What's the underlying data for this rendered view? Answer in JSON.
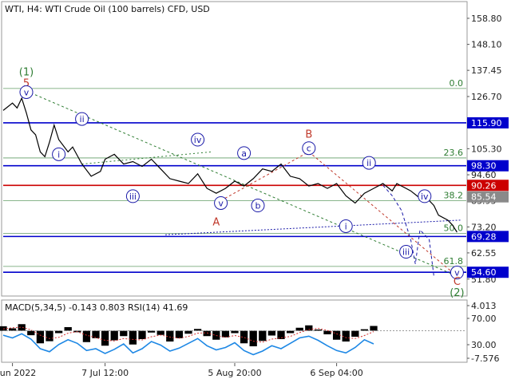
{
  "header": {
    "title": "WTI, H4:  WTI Crude Oil (100 barrels) CFD, USD"
  },
  "colors": {
    "price": "#000000",
    "level_line": "#0000cc",
    "current_line": "#cc0000",
    "fib_line": "#2e7d32",
    "wave_blue": "#1a1aa8",
    "wave_red": "#c0392b",
    "wave_green": "#2e7d32",
    "macd_hist": "#000000",
    "rsi": "#1e88e5",
    "signal": "#d32f2f"
  },
  "chart_data": [
    {
      "type": "line",
      "name": "main",
      "ylim": [
        45.5,
        165
      ],
      "y_ticks": [
        158.8,
        148.1,
        137.45,
        126.7,
        116.05,
        105.3,
        94.6,
        83.95,
        73.2,
        62.55,
        51.8
      ],
      "x_ticks": [
        "8 Jun 2022",
        "7 Jul 12:00",
        "5 Aug 20:00",
        "6 Sep 04:00"
      ],
      "x": [
        0,
        2,
        3,
        4,
        5,
        6,
        7,
        8,
        9,
        10,
        11,
        12,
        14,
        15,
        17,
        19,
        21,
        22,
        24,
        26,
        28,
        30,
        32,
        34,
        36,
        38,
        40,
        42,
        44,
        46,
        48,
        50,
        52,
        54,
        56,
        58,
        60,
        62,
        64,
        66,
        68,
        70,
        72,
        74,
        76,
        78,
        80,
        82,
        84,
        85,
        86,
        88,
        90,
        92,
        93,
        94,
        96,
        97,
        98
      ],
      "series": [
        {
          "name": "price",
          "values": [
            121,
            124,
            122,
            126,
            120,
            113,
            111,
            104,
            102,
            108,
            115,
            109,
            104,
            106,
            99,
            94,
            96,
            101,
            103,
            99,
            100,
            98,
            101,
            97,
            93,
            92,
            91,
            95,
            89,
            87,
            89,
            92,
            90,
            93,
            97,
            96,
            99,
            94,
            93,
            90,
            91,
            89,
            91,
            86,
            83,
            87,
            89,
            91,
            88,
            91,
            90,
            88,
            85,
            84,
            82,
            78,
            76,
            74,
            71
          ]
        },
        {
          "name": "forecast",
          "x": [
            82,
            84,
            86,
            88,
            89,
            90,
            92,
            93
          ],
          "values": [
            90.3,
            86,
            80,
            68,
            58,
            72,
            68,
            53
          ]
        }
      ],
      "horizontal_levels": [
        {
          "value": 115.9,
          "label": "115.90",
          "kind": "level"
        },
        {
          "value": 98.3,
          "label": "98.30",
          "kind": "level"
        },
        {
          "value": 90.26,
          "label": "90.26",
          "kind": "current"
        },
        {
          "value": 85.54,
          "label": "85.54",
          "kind": "price"
        },
        {
          "value": 69.28,
          "label": "69.28",
          "kind": "level"
        },
        {
          "value": 54.6,
          "label": "54.60",
          "kind": "level"
        }
      ],
      "fib_levels": [
        {
          "value": 130.0,
          "label": "0.0"
        },
        {
          "value": 101.5,
          "label": "23.6"
        },
        {
          "value": 84.0,
          "label": "38.2"
        },
        {
          "value": 70.5,
          "label": "50.0"
        },
        {
          "value": 57.0,
          "label": "61.8"
        }
      ],
      "wave_labels": [
        {
          "text": "(1)",
          "x": 5,
          "y": 137.0,
          "style": "green"
        },
        {
          "text": "5",
          "x": 5,
          "y": 132.5,
          "style": "red"
        },
        {
          "text": "v",
          "x": 5,
          "y": 128.5,
          "style": "blue_circle"
        },
        {
          "text": "i",
          "x": 12,
          "y": 103.0,
          "style": "blue_circle"
        },
        {
          "text": "ii",
          "x": 17,
          "y": 117.5,
          "style": "blue_circle"
        },
        {
          "text": "iii",
          "x": 28,
          "y": 85.8,
          "style": "blue_circle"
        },
        {
          "text": "iv",
          "x": 42,
          "y": 109.0,
          "style": "blue_circle"
        },
        {
          "text": "v",
          "x": 47,
          "y": 83.0,
          "style": "blue_circle"
        },
        {
          "text": "A",
          "x": 46,
          "y": 75.5,
          "style": "red"
        },
        {
          "text": "a",
          "x": 52,
          "y": 103.5,
          "style": "blue_circle"
        },
        {
          "text": "b",
          "x": 55,
          "y": 82.0,
          "style": "blue_circle"
        },
        {
          "text": "B",
          "x": 66,
          "y": 111.5,
          "style": "red"
        },
        {
          "text": "c",
          "x": 66,
          "y": 105.5,
          "style": "blue_circle"
        },
        {
          "text": "i",
          "x": 74,
          "y": 73.5,
          "style": "blue_circle"
        },
        {
          "text": "ii",
          "x": 79,
          "y": 99.5,
          "style": "blue_circle"
        },
        {
          "text": "iii",
          "x": 87,
          "y": 63.0,
          "style": "blue_circle"
        },
        {
          "text": "iv",
          "x": 91,
          "y": 85.8,
          "style": "blue_circle"
        },
        {
          "text": "v",
          "x": 98,
          "y": 54.5,
          "style": "blue_circle"
        },
        {
          "text": "C",
          "x": 98,
          "y": 51.0,
          "style": "red"
        },
        {
          "text": "(2)",
          "x": 98,
          "y": 46.5,
          "style": "green"
        }
      ]
    },
    {
      "type": "bar",
      "name": "indicator",
      "label": "MACD(5,34,5) -0.143 0.803 RSI(14) 41.69",
      "ylim": [
        -10,
        6
      ],
      "y_ticks": [
        4.013,
        70.0,
        30.0,
        -7.576
      ],
      "x": [
        0,
        2,
        4,
        6,
        8,
        10,
        12,
        14,
        16,
        18,
        20,
        22,
        24,
        26,
        28,
        30,
        32,
        34,
        36,
        38,
        40,
        42,
        44,
        46,
        48,
        50,
        52,
        54,
        56,
        58,
        60,
        62,
        64,
        66,
        68,
        70,
        72,
        74,
        76,
        78,
        80
      ],
      "series": [
        {
          "name": "macd_hist",
          "values": [
            1.5,
            0.8,
            2.2,
            -1.5,
            -4.2,
            -3.5,
            -0.8,
            1.2,
            -0.5,
            -3.8,
            -2.5,
            -5.0,
            -3.2,
            -1.8,
            -4.6,
            -2.8,
            -0.6,
            -1.4,
            -3.6,
            -2.5,
            -1.0,
            0.6,
            -1.8,
            -3.0,
            -2.2,
            -0.8,
            -4.2,
            -5.2,
            -3.4,
            -1.6,
            -2.8,
            -0.8,
            1.0,
            1.8,
            0.4,
            -1.2,
            -3.0,
            -3.6,
            -2.0,
            0.5,
            1.6
          ]
        },
        {
          "name": "signal",
          "values": [
            0.6,
            1.0,
            1.2,
            0.3,
            -1.5,
            -2.6,
            -2.2,
            -0.8,
            -0.3,
            -1.5,
            -2.3,
            -3.2,
            -3.4,
            -2.6,
            -2.9,
            -3.1,
            -2.0,
            -1.4,
            -2.1,
            -2.5,
            -1.9,
            -0.8,
            -0.7,
            -1.6,
            -2.2,
            -1.6,
            -2.2,
            -3.5,
            -3.8,
            -2.8,
            -2.4,
            -1.9,
            -0.6,
            0.4,
            0.8,
            0.1,
            -1.0,
            -2.3,
            -2.6,
            -1.6,
            -0.3
          ]
        },
        {
          "name": "rsi",
          "values": [
            -1.5,
            -2.4,
            -1.0,
            -2.8,
            -6.0,
            -7.0,
            -4.6,
            -3.0,
            -4.2,
            -6.6,
            -6.0,
            -7.6,
            -6.2,
            -4.4,
            -7.4,
            -6.0,
            -3.6,
            -4.8,
            -6.8,
            -5.8,
            -4.2,
            -2.6,
            -5.0,
            -6.4,
            -5.6,
            -4.0,
            -6.6,
            -8.0,
            -6.8,
            -5.0,
            -6.0,
            -4.2,
            -2.4,
            -1.8,
            -3.2,
            -5.0,
            -6.6,
            -7.4,
            -5.6,
            -3.0,
            -4.4
          ]
        }
      ]
    }
  ]
}
